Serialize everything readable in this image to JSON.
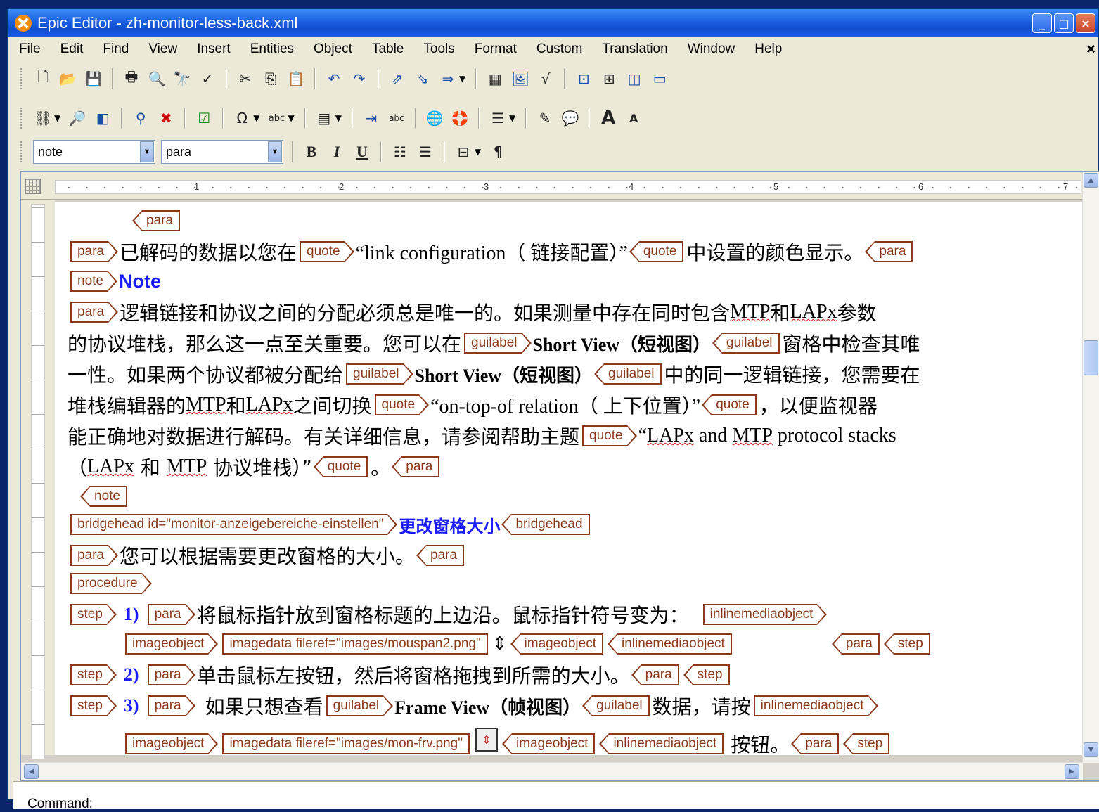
{
  "window": {
    "title": "Epic Editor - zh-monitor-less-back.xml",
    "controls": {
      "minimize": "_",
      "maximize": "□",
      "close": "×"
    }
  },
  "menubar": {
    "items": [
      "File",
      "Edit",
      "Find",
      "View",
      "Insert",
      "Entities",
      "Object",
      "Table",
      "Tools",
      "Format",
      "Custom",
      "Translation",
      "Window",
      "Help"
    ],
    "doc_close": "×"
  },
  "toolbar3": {
    "element_combo": "note",
    "style_combo": "para",
    "bold": "B",
    "italic": "I",
    "underline": "U",
    "pilcrow": "¶"
  },
  "ruler": {
    "numbers": [
      "1",
      "2",
      "3",
      "4",
      "5",
      "6",
      "7"
    ]
  },
  "document": {
    "line1": {
      "tag": "para"
    },
    "line2": {
      "tag_para": "para",
      "text1": "已解码的数据以您在",
      "tag_quote": "quote",
      "quoted": "“link configuration（ 链接配置）”",
      "text2": "中设置的颜色显示。",
      "tag_para_end": "para"
    },
    "line3": {
      "tag": "note",
      "title": "Note"
    },
    "line4": {
      "tag": "para",
      "text1": "逻辑链接和协议之间的分配必须总是唯一的。如果测量中存在同时包含 ",
      "mtp": "MTP",
      "text2": " 和 ",
      "lapx": "LAPx",
      "text3": " 参数"
    },
    "line5": {
      "text1": "的协议堆栈，那么这一点至关重要。您可以在 ",
      "tag_gl": "guilabel",
      "gl_text": "Short View（短视图）",
      "text2": "窗格中检查其唯"
    },
    "line6": {
      "text1": "一性。如果两个协议都被分配给 ",
      "tag_gl": "guilabel",
      "gl_text": "Short View（短视图）",
      "text2": "中的同一逻辑链接，您需要在"
    },
    "line7": {
      "text1": "堆栈编辑器的 ",
      "mtp": "MTP",
      "text2": " 和 ",
      "lapx": "LAPx",
      "text3": " 之间切换",
      "tag_quote": "quote",
      "quoted": "“on-top-of relation（ 上下位置）”",
      "text4": "，以便监视器"
    },
    "line8": {
      "text1": "能正确地对数据进行解码。有关详细信息，请参阅帮助主题",
      "tag_quote": "quote",
      "quoted1": "“",
      "lapx": "LAPx",
      "quoted2": " and ",
      "mtp": "MTP",
      "quoted3": " protocol stacks"
    },
    "line9": {
      "text1": "（",
      "lapx": "LAPx",
      "text2": " 和 ",
      "mtp": "MTP",
      "text3": " 协议堆栈）”",
      "tag_quote": "quote",
      "text4": "。",
      "tag_para": "para"
    },
    "line10": {
      "tag": "note"
    },
    "line11": {
      "tag_bh": "bridgehead id=\"monitor-anzeigebereiche-einstellen\"",
      "title": "更改窗格大小",
      "tag_bh_end": "bridgehead"
    },
    "line12": {
      "tag": "para",
      "text": "您可以根据需要更改窗格的大小。",
      "tag_end": "para"
    },
    "line13": {
      "tag": "procedure"
    },
    "line14": {
      "tag_step": "step",
      "num": "1)",
      "tag_para": "para",
      "text": "将鼠标指针放到窗格标题的上边沿。鼠标指针符号变为：",
      "tag_inline": "inlinemediaobject"
    },
    "line15": {
      "tag_imgobj": "imageobject",
      "tag_imgdata": "imagedata fileref=\"images/mouspan2.png\"",
      "cursor": "⇕",
      "tag_imgobj_end": "imageobject",
      "tag_inline_end": "inlinemediaobject",
      "tag_para_end": "para",
      "tag_step_end": "step"
    },
    "line16": {
      "tag_step": "step",
      "num": "2)",
      "tag_para": "para",
      "text": "单击鼠标左按钮，然后将窗格拖拽到所需的大小。",
      "tag_para_end": "para",
      "tag_step_end": "step"
    },
    "line17": {
      "tag_step": "step",
      "num": "3)",
      "tag_para": "para",
      "text1": "如果只想查看 ",
      "tag_gl": "guilabel",
      "gl_text": "Frame View（帧视图）",
      "text2": "数据，请按 ",
      "tag_inline": "inlinemediaobject"
    },
    "line18": {
      "tag_imgobj": "imageobject",
      "tag_imgdata": "imagedata fileref=\"images/mon-frv.png\"",
      "tag_imgobj_end": "imageobject",
      "tag_inline_end": "inlinemediaobject",
      "text": "按钮。",
      "tag_para_end": "para",
      "tag_step_end": "step"
    }
  },
  "command": {
    "label": "Command:"
  }
}
